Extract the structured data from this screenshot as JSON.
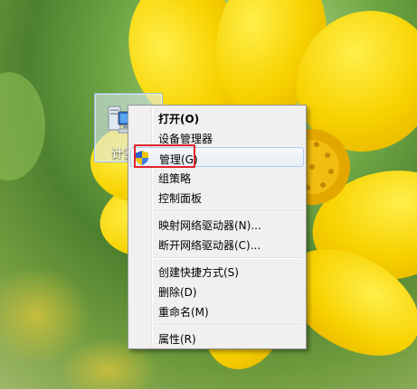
{
  "desktop": {
    "icon_label": "计算机"
  },
  "context_menu": {
    "items": [
      {
        "label": "打开(O)"
      },
      {
        "label": "设备管理器"
      },
      {
        "label": "管理(G)"
      },
      {
        "label": "组策略"
      },
      {
        "label": "控制面板"
      },
      {
        "label": "映射网络驱动器(N)..."
      },
      {
        "label": "断开网络驱动器(C)..."
      },
      {
        "label": "创建快捷方式(S)"
      },
      {
        "label": "删除(D)"
      },
      {
        "label": "重命名(M)"
      },
      {
        "label": "属性(R)"
      }
    ]
  },
  "colors": {
    "highlight_box": "#e0242a",
    "flower_yellow": "#f7d600",
    "flower_center": "#e0a400"
  }
}
